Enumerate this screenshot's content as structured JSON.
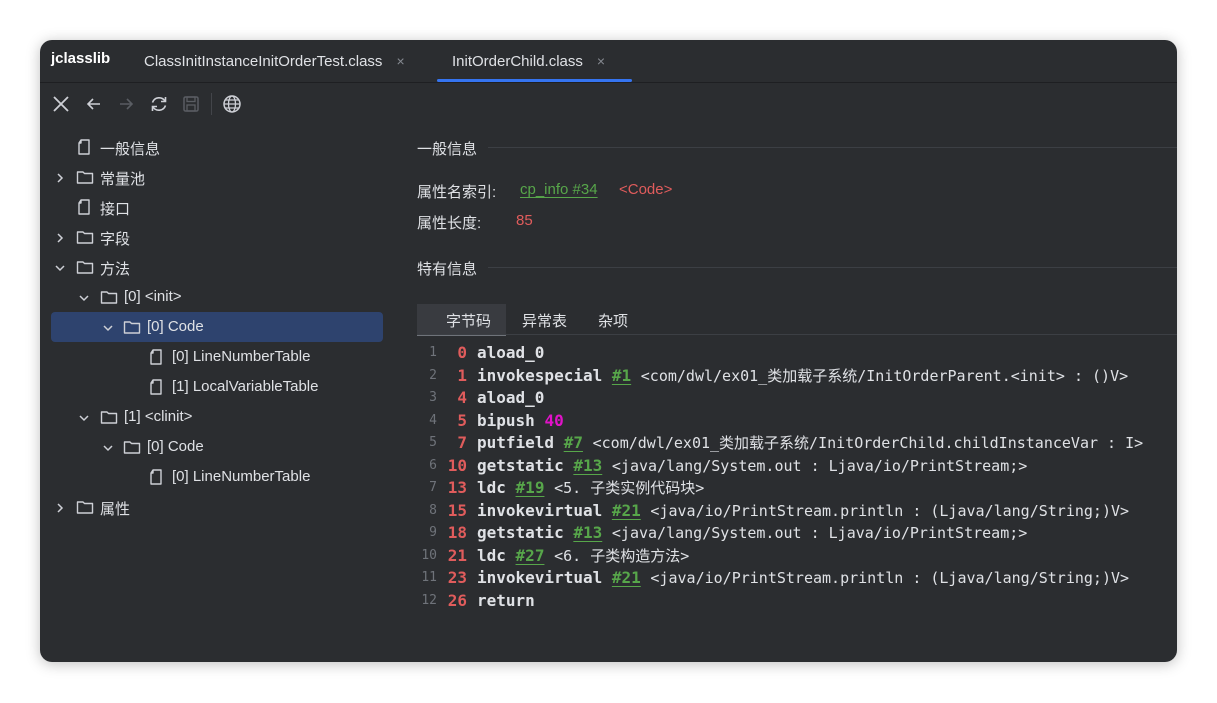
{
  "app_title": "jclasslib",
  "tabs": [
    {
      "label": "ClassInitInstanceInitOrderTest.class",
      "close": "×"
    },
    {
      "label": "InitOrderChild.class",
      "close": "×"
    }
  ],
  "tree": [
    {
      "label": "一般信息"
    },
    {
      "label": "常量池"
    },
    {
      "label": "接口"
    },
    {
      "label": "字段"
    },
    {
      "label": "方法"
    },
    {
      "label": "[0] <init>"
    },
    {
      "label": "[0] Code"
    },
    {
      "label": "[0] LineNumberTable"
    },
    {
      "label": "[1] LocalVariableTable"
    },
    {
      "label": "[1] <clinit>"
    },
    {
      "label": "[0] Code"
    },
    {
      "label": "[0] LineNumberTable"
    },
    {
      "label": "属性"
    }
  ],
  "general": {
    "section_title": "一般信息",
    "name_index_label": "属性名索引:",
    "name_index_link": "cp_info #34",
    "name_index_value": "<Code>",
    "length_label": "属性长度:",
    "length_value": "85"
  },
  "specific": {
    "section_title": "特有信息"
  },
  "bytecode_tabs": [
    "字节码",
    "异常表",
    "杂项"
  ],
  "bytecode": [
    {
      "line": "1",
      "offset": "0",
      "instr": "aload_0",
      "op": "",
      "num": "",
      "comment": ""
    },
    {
      "line": "2",
      "offset": "1",
      "instr": "invokespecial",
      "op": "#1",
      "num": "",
      "comment": "<com/dwl/ex01_类加载子系统/InitOrderParent.<init> : ()V>"
    },
    {
      "line": "3",
      "offset": "4",
      "instr": "aload_0",
      "op": "",
      "num": "",
      "comment": ""
    },
    {
      "line": "4",
      "offset": "5",
      "instr": "bipush",
      "op": "",
      "num": "40",
      "comment": ""
    },
    {
      "line": "5",
      "offset": "7",
      "instr": "putfield",
      "op": "#7",
      "num": "",
      "comment": "<com/dwl/ex01_类加载子系统/InitOrderChild.childInstanceVar : I>"
    },
    {
      "line": "6",
      "offset": "10",
      "instr": "getstatic",
      "op": "#13",
      "num": "",
      "comment": "<java/lang/System.out : Ljava/io/PrintStream;>"
    },
    {
      "line": "7",
      "offset": "13",
      "instr": "ldc",
      "op": "#19",
      "num": "",
      "comment": "<5. 子类实例代码块>"
    },
    {
      "line": "8",
      "offset": "15",
      "instr": "invokevirtual",
      "op": "#21",
      "num": "",
      "comment": "<java/io/PrintStream.println : (Ljava/lang/String;)V>"
    },
    {
      "line": "9",
      "offset": "18",
      "instr": "getstatic",
      "op": "#13",
      "num": "",
      "comment": "<java/lang/System.out : Ljava/io/PrintStream;>"
    },
    {
      "line": "10",
      "offset": "21",
      "instr": "ldc",
      "op": "#27",
      "num": "",
      "comment": "<6. 子类构造方法>"
    },
    {
      "line": "11",
      "offset": "23",
      "instr": "invokevirtual",
      "op": "#21",
      "num": "",
      "comment": "<java/io/PrintStream.println : (Ljava/lang/String;)V>"
    },
    {
      "line": "12",
      "offset": "26",
      "instr": "return",
      "op": "",
      "num": "",
      "comment": ""
    }
  ],
  "colors": {
    "accent": "#3574f0",
    "selection": "#2e436e",
    "offset": "#e05c5c",
    "link": "#57a64a",
    "number": "#e012c8",
    "background": "#2b2d30"
  },
  "toolbar_icons": [
    "close-icon",
    "back-arrow-icon",
    "forward-arrow-icon",
    "refresh-icon",
    "save-icon",
    "globe-icon"
  ]
}
